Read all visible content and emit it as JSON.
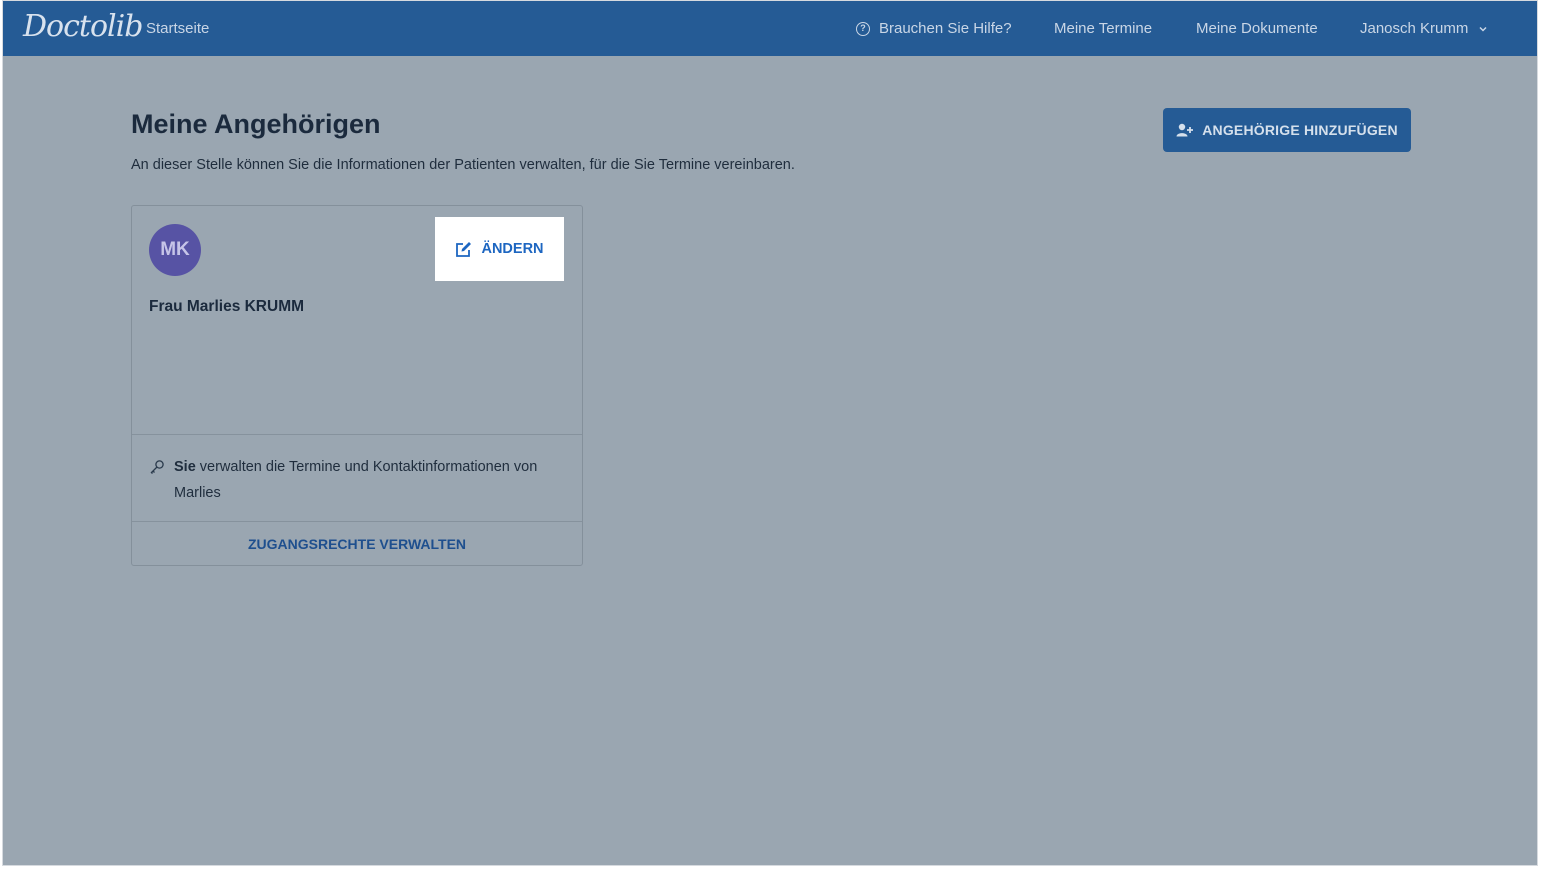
{
  "header": {
    "logo": "Doctolib",
    "home_link": "Startseite",
    "help_link": "Brauchen Sie Hilfe?",
    "appointments_link": "Meine Termine",
    "documents_link": "Meine Dokumente",
    "user_name": "Janosch Krumm"
  },
  "page": {
    "title": "Meine Angehörigen",
    "subtitle": "An dieser Stelle können Sie die Informationen der Patienten verwalten, für die Sie Termine vereinbaren.",
    "add_button": "ANGEHÖRIGE HINZUFÜGEN"
  },
  "relative_card": {
    "avatar_initials": "MK",
    "edit_button": "ÄNDERN",
    "name": "Frau Marlies KRUMM",
    "access_bold": "Sie",
    "access_text": " verwalten die Termine und Kontaktinformationen von Marlies",
    "manage_link": "ZUGANGSRECHTE VERWALTEN"
  },
  "colors": {
    "navbar": "#255b95",
    "overlay_background": "#9aa6b1",
    "avatar": "#5753a4",
    "accent_link": "#1d66c1"
  },
  "icons": [
    "help-circle-icon",
    "chevron-down-icon",
    "add-user-icon",
    "edit-icon",
    "key-icon"
  ]
}
